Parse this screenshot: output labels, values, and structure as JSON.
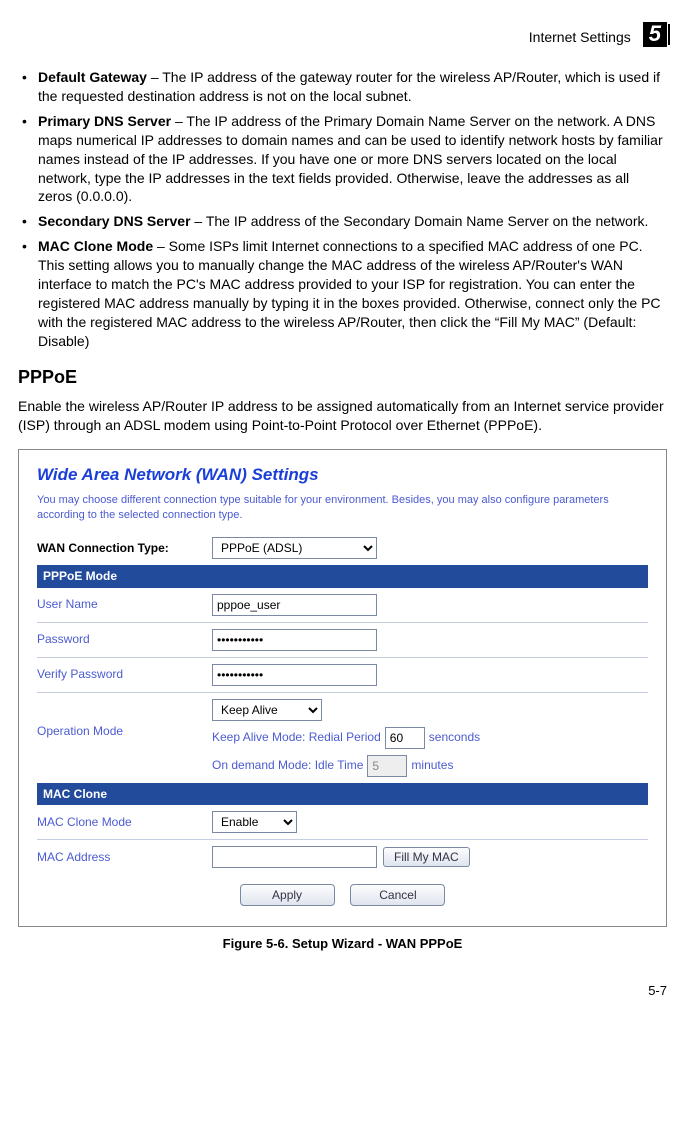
{
  "header": {
    "title": "Internet Settings",
    "chapter": "5"
  },
  "bullets": [
    {
      "term": "Default Gateway",
      "text": " – The IP address of the gateway router for the wireless AP/Router, which is used if the requested destination address is not on the local subnet."
    },
    {
      "term": "Primary DNS Server",
      "text": " – The IP address of the Primary Domain Name Server on the network. A DNS maps numerical IP addresses to domain names and can be used to identify network hosts by familiar names instead of the IP addresses. If you have one or more DNS servers located on the local network, type the IP addresses in the text fields provided. Otherwise, leave the addresses as all zeros (0.0.0.0)."
    },
    {
      "term": "Secondary DNS Server",
      "text": " – The IP address of the Secondary Domain Name Server on the network."
    },
    {
      "term": "MAC Clone Mode",
      "text": " – Some ISPs limit Internet connections to a specified MAC address of one PC. This setting allows you to manually change the MAC address of the wireless AP/Router's WAN interface to match the PC's MAC address provided to your ISP for registration. You can enter the registered MAC address manually by typing it in the boxes provided. Otherwise, connect only the PC with the registered MAC address to the wireless AP/Router, then click the “Fill My MAC” (Default: Disable)"
    }
  ],
  "section": {
    "heading": "PPPoE",
    "intro": "Enable the wireless AP/Router IP address to be assigned automatically from an Internet service provider (ISP) through an ADSL modem using Point-to-Point Protocol over Ethernet (PPPoE)."
  },
  "figure": {
    "wan_title": "Wide Area Network (WAN) Settings",
    "wan_desc": "You may choose different connection type suitable for your environment. Besides, you may also configure parameters according to the selected connection type.",
    "conn_label": "WAN Connection Type:",
    "conn_value": "PPPoE (ADSL)",
    "bar_pppoe": "PPPoE Mode",
    "user_label": "User Name",
    "user_value": "pppoe_user",
    "pass_label": "Password",
    "pass_value": "•••••••••••",
    "verify_label": "Verify Password",
    "verify_value": "•••••••••••",
    "op_label": "Operation Mode",
    "op_value": "Keep Alive",
    "keepalive_prefix": "Keep Alive Mode: Redial Period",
    "keepalive_value": "60",
    "keepalive_suffix": "senconds",
    "ondemand_prefix": "On demand Mode: Idle Time",
    "ondemand_value": "5",
    "ondemand_suffix": "minutes",
    "bar_mac": "MAC Clone",
    "macmode_label": "MAC Clone Mode",
    "macmode_value": "Enable",
    "macaddr_label": "MAC Address",
    "macaddr_value": "",
    "fillmac": "Fill My MAC",
    "apply": "Apply",
    "cancel": "Cancel",
    "caption": "Figure 5-6.   Setup Wizard - WAN PPPoE"
  },
  "page": "5-7"
}
